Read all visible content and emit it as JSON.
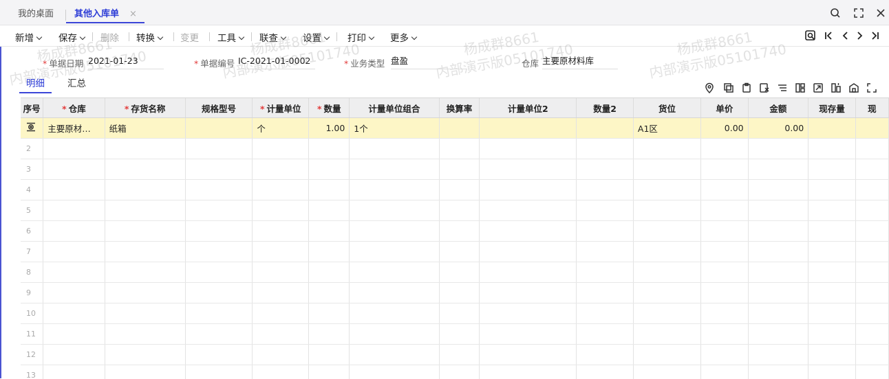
{
  "tabs": {
    "home": "我的桌面",
    "active": "其他入库单",
    "close": "×"
  },
  "toolbar": [
    {
      "label": "新增",
      "dropdown": true,
      "disabled": false
    },
    {
      "label": "保存",
      "dropdown": true,
      "disabled": false
    },
    {
      "label": "删除",
      "dropdown": false,
      "disabled": true
    },
    {
      "label": "转换",
      "dropdown": true,
      "disabled": false
    },
    {
      "label": "变更",
      "dropdown": false,
      "disabled": true
    },
    {
      "label": "工具",
      "dropdown": true,
      "disabled": false
    },
    {
      "label": "联查",
      "dropdown": true,
      "disabled": false
    },
    {
      "label": "设置",
      "dropdown": true,
      "disabled": false
    },
    {
      "label": "打印",
      "dropdown": true,
      "disabled": false
    },
    {
      "label": "更多",
      "dropdown": true,
      "disabled": false
    }
  ],
  "form": {
    "date": {
      "label": "单据日期",
      "value": "2021-01-23"
    },
    "code": {
      "label": "单据编号",
      "value": "IC-2021-01-0002"
    },
    "biz_type": {
      "label": "业务类型",
      "value": "盘盈"
    },
    "warehouse": {
      "label": "仓库",
      "value": "主要原材料库"
    }
  },
  "subtabs": {
    "detail": "明细",
    "summary": "汇总"
  },
  "grid": {
    "columns": [
      "序号",
      "仓库",
      "存货名称",
      "规格型号",
      "计量单位",
      "数量",
      "计量单位组合",
      "换算率",
      "计量单位2",
      "数量2",
      "货位",
      "单价",
      "金额",
      "现存量",
      "现"
    ],
    "required": [
      false,
      true,
      true,
      false,
      true,
      true,
      false,
      false,
      false,
      false,
      false,
      false,
      false,
      false,
      false
    ],
    "rows": [
      {
        "seq": "",
        "warehouse": "主要原材…",
        "item": "纸箱",
        "spec": "",
        "unit": "个",
        "qty": "1.00",
        "unit_combo": "1个",
        "rate": "",
        "unit2": "",
        "qty2": "",
        "location": "A1区",
        "price": "0.00",
        "amount": "0.00",
        "stock": "",
        "extra": ""
      },
      {
        "seq": "2"
      },
      {
        "seq": "3"
      },
      {
        "seq": "4"
      },
      {
        "seq": "5"
      },
      {
        "seq": "6"
      },
      {
        "seq": "7"
      },
      {
        "seq": "8"
      },
      {
        "seq": "9"
      },
      {
        "seq": "10"
      },
      {
        "seq": "11"
      },
      {
        "seq": "12"
      },
      {
        "seq": "13"
      }
    ]
  },
  "watermark": {
    "line1": "杨成群8661",
    "line2": "内部演示版05101740"
  },
  "colors": {
    "accent": "#3b46d8",
    "required": "#e23b3b",
    "selected_row": "#fdf6c6"
  }
}
